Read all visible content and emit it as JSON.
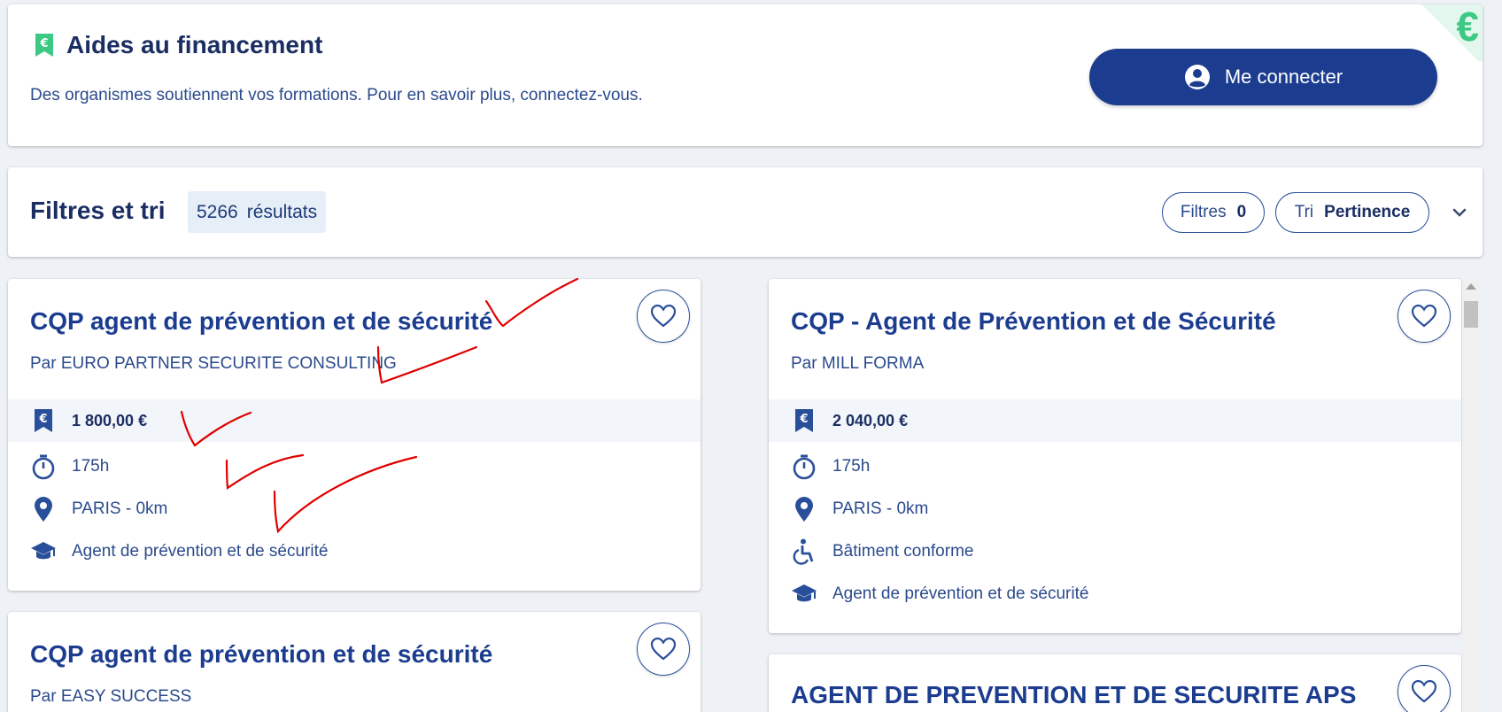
{
  "aides": {
    "title": "Aides au financement",
    "description": "Des organismes soutiennent vos formations. Pour en savoir plus, connectez-vous.",
    "login_label": "Me connecter"
  },
  "filters": {
    "title": "Filtres et tri",
    "results_count": "5266",
    "results_label": "résultats",
    "filtres_label": "Filtres",
    "filtres_count": "0",
    "tri_label": "Tri",
    "tri_value": "Pertinence"
  },
  "courses": [
    {
      "title": "CQP agent de prévention et de sécurité",
      "organization": "Par EURO PARTNER SECURITE CONSULTING",
      "price": "1 800,00 €",
      "duration": "175h",
      "location": "PARIS - 0km",
      "diploma": "Agent de prévention et de sécurité"
    },
    {
      "title": "CQP - Agent de Prévention et de Sécurité",
      "organization": "Par MILL FORMA",
      "price": "2 040,00 €",
      "duration": "175h",
      "location": "PARIS - 0km",
      "accessibility": "Bâtiment conforme",
      "diploma": "Agent de prévention et de sécurité"
    },
    {
      "title": "CQP agent de prévention et de sécurité",
      "organization": "Par EASY SUCCESS"
    },
    {
      "title": "AGENT DE PREVENTION ET DE SECURITE APS"
    }
  ],
  "icons": {
    "finance": "euro-bookmark-icon",
    "duration": "stopwatch-icon",
    "location": "map-pin-icon",
    "accessibility": "wheelchair-icon",
    "diploma": "graduation-cap-icon",
    "favorite": "heart-icon",
    "user": "user-circle-icon"
  },
  "colors": {
    "primary": "#1c3d8f",
    "accent_green": "#3cc984",
    "annotation_red": "#e00000"
  }
}
